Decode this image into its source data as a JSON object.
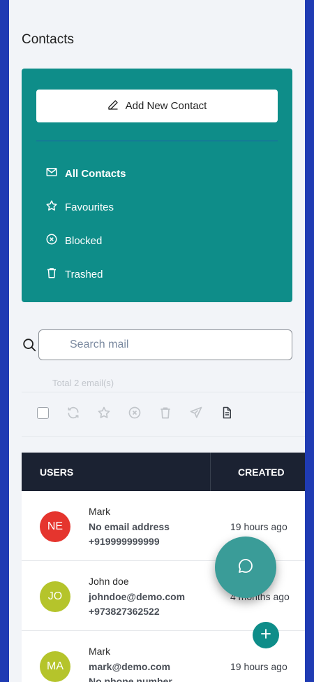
{
  "page": {
    "title": "Contacts"
  },
  "sidebar": {
    "add_button_label": "Add New Contact",
    "items": [
      {
        "label": "All Contacts",
        "icon": "mail-icon"
      },
      {
        "label": "Favourites",
        "icon": "star-icon"
      },
      {
        "label": "Blocked",
        "icon": "circle-x-icon"
      },
      {
        "label": "Trashed",
        "icon": "trash-icon"
      }
    ]
  },
  "search": {
    "placeholder": "Search mail",
    "value": ""
  },
  "list": {
    "total_text": "Total 2 email(s)"
  },
  "table": {
    "headers": {
      "users": "USERS",
      "created": "CREATED"
    },
    "rows": [
      {
        "initials": "NE",
        "avatar_color": "#e5352e",
        "name": "Mark",
        "email": "No email address",
        "phone": "+919999999999",
        "created": "19 hours ago"
      },
      {
        "initials": "JO",
        "avatar_color": "#b5c42b",
        "name": "John doe",
        "email": "johndoe@demo.com",
        "phone": "+973827362522",
        "created": "4 months ago"
      },
      {
        "initials": "MA",
        "avatar_color": "#b5c42b",
        "name": "Mark",
        "email": "mark@demo.com",
        "phone": "No phone number",
        "created": "19 hours ago"
      }
    ]
  },
  "colors": {
    "accent": "#0e8d89",
    "frame": "#1f3bb3",
    "table_header": "#1b2232",
    "fab": "#3a9c98"
  }
}
